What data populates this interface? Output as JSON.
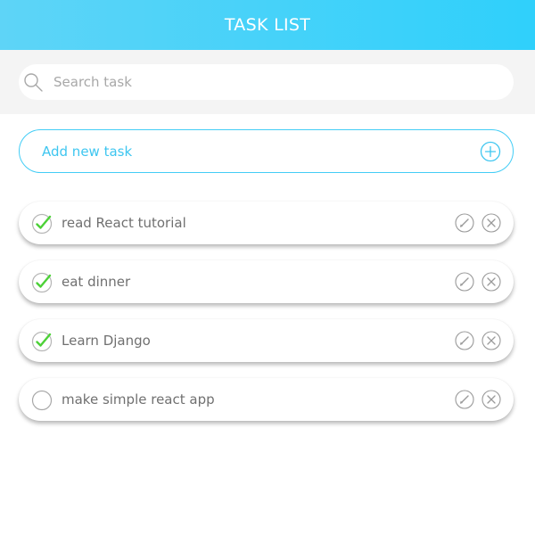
{
  "header": {
    "title": "TASK LIST"
  },
  "search": {
    "placeholder": "Search task",
    "value": ""
  },
  "add_task": {
    "label": "Add new task"
  },
  "tasks": [
    {
      "label": "read React tutorial",
      "done": true
    },
    {
      "label": "eat dinner",
      "done": true
    },
    {
      "label": "Learn Django",
      "done": true
    },
    {
      "label": "make simple react app",
      "done": false
    }
  ],
  "colors": {
    "header_gradient_start": "#5ed4f7",
    "header_gradient_end": "#2fd0fb",
    "accent": "#3ec6f0",
    "check_green": "#4cd137",
    "icon_gray": "#9a9a9a"
  }
}
